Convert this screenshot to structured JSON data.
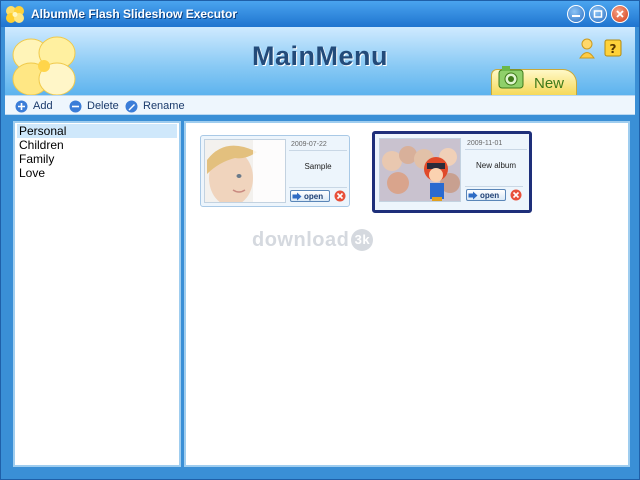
{
  "window": {
    "title": "AlbumMe Flash Slideshow Executor"
  },
  "header": {
    "title": "MainMenu",
    "new_tab_label": "New"
  },
  "toolbar": {
    "add_label": "Add",
    "delete_label": "Delete",
    "rename_label": "Rename"
  },
  "categories": [
    {
      "label": "Personal",
      "selected": true
    },
    {
      "label": "Children",
      "selected": false
    },
    {
      "label": "Family",
      "selected": false
    },
    {
      "label": "Love",
      "selected": false
    }
  ],
  "albums": [
    {
      "date": "2009-07-22",
      "name": "Sample",
      "open_label": "open",
      "selected": false
    },
    {
      "date": "2009-11-01",
      "name": "New album",
      "open_label": "open",
      "selected": true
    }
  ],
  "watermark": {
    "text": "download",
    "badge": "3k"
  },
  "colors": {
    "titlebar": "#2a7fd6",
    "selection_border": "#1e2f7a",
    "accent_new": "#3f7a1a"
  }
}
